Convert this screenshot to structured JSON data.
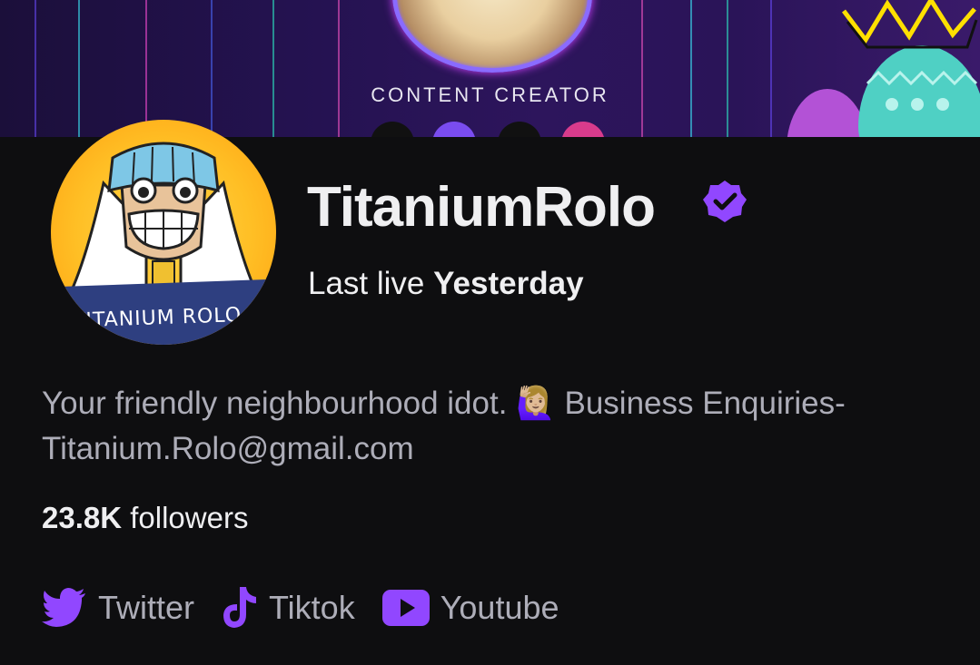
{
  "banner": {
    "tagline": "CONTENT CREATOR"
  },
  "profile": {
    "username": "TitaniumRolo",
    "avatar_caption": "TITANIUM ROLO",
    "last_live_prefix": "Last live",
    "last_live_value": "Yesterday",
    "bio_prefix": "Your friendly neighbourhood idot.",
    "bio_emoji": "🙋🏼‍♀️",
    "bio_suffix": "Business Enquiries- Titanium.Rolo@gmail.com",
    "followers_count": "23.8K",
    "followers_label": "followers",
    "verified_icon": "verified-badge-icon"
  },
  "links": [
    {
      "label": "Twitter",
      "icon": "twitter-icon"
    },
    {
      "label": "Tiktok",
      "icon": "tiktok-icon"
    },
    {
      "label": "Youtube",
      "icon": "youtube-icon"
    }
  ],
  "colors": {
    "accent": "#9147ff",
    "background": "#0e0e10",
    "text_primary": "#efeff1",
    "text_secondary": "#adadb8"
  }
}
